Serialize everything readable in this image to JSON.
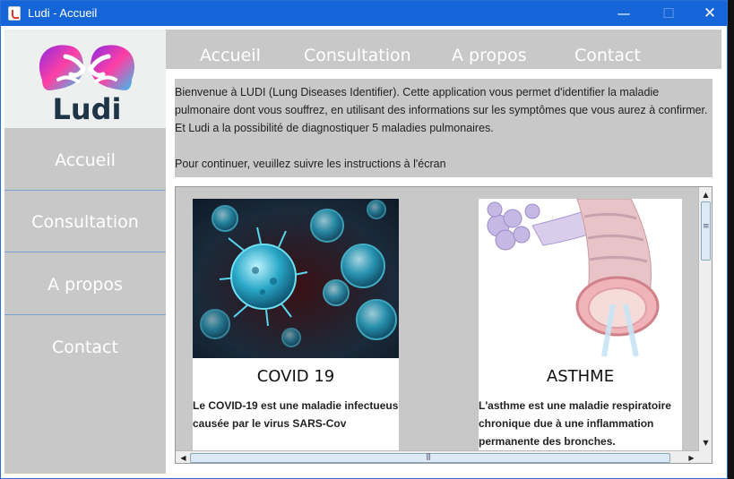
{
  "window": {
    "title": "Ludi - Accueil",
    "controls": {
      "minimize": "—",
      "maximize": "☐",
      "close": "✕"
    }
  },
  "logo": {
    "text": "Ludi",
    "colors": [
      "#8a2be2",
      "#ff3fa4",
      "#2ec4f0"
    ]
  },
  "sidebar": {
    "items": [
      {
        "label": "Accueil"
      },
      {
        "label": "Consultation"
      },
      {
        "label": "A propos"
      },
      {
        "label": "Contact"
      }
    ]
  },
  "topnav": {
    "items": [
      {
        "label": "Accueil"
      },
      {
        "label": "Consultation"
      },
      {
        "label": "A propos"
      },
      {
        "label": "Contact"
      }
    ]
  },
  "intro": {
    "paragraph": "Bienvenue à LUDI (Lung Diseases Identifier). Cette application vous permet d'identifier la maladie pulmonaire dont vous souffrez, en utilisant des informations sur les symptômes que vous aurez à confirmer. Et Ludi a la possibilité de diagnostiquer 5 maladies pulmonaires.",
    "instruction": "Pour continuer, veuillez suivre les instructions à l'écran"
  },
  "cards": [
    {
      "title": "COVID 19",
      "description": "Le COVID-19 est une maladie infectueuse causée par le virus SARS-Cov",
      "image": "coronavirus-image"
    },
    {
      "title": "ASTHME",
      "description": "L'asthme est une maladie respiratoire chronique due à une inflammation permanente des bronches.",
      "image": "bronchi-image"
    }
  ],
  "scrollbars": {
    "up": "▲",
    "down": "▼",
    "left": "◀",
    "right": "▶"
  },
  "colors": {
    "titlebar": "#1565d8",
    "panel": "#c8c8c8",
    "nav_text": "#ffffff",
    "divider": "#7a9fd0"
  }
}
